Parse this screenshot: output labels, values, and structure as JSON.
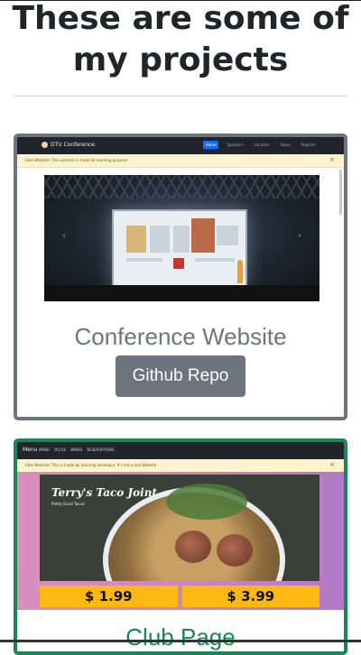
{
  "page": {
    "heading": "These are some of my projects"
  },
  "projects": [
    {
      "title": "Conference Website",
      "button_label": "Github Repo",
      "preview": {
        "brand": "DTU Conference",
        "nav": [
          "Home",
          "Speakers",
          "Location",
          "News",
          "Register"
        ],
        "alert": "Fake Website! This website is made for learning purpose"
      }
    },
    {
      "title": "Club Page",
      "preview": {
        "brand": "Menu",
        "nav": [
          "MENU",
          "TACOS",
          "WINES",
          "RESERVATIONS"
        ],
        "alert": "Fake Website! This is made by learning developer. It's not a real Website",
        "hero_title": "Terry's Taco Joint",
        "hero_subtitle": "Pretty Good Tacos!",
        "prices": [
          "$ 1.99",
          "$ 3.99"
        ]
      }
    }
  ],
  "colors": {
    "secondary": "#6c757d",
    "success": "#198754",
    "price_bg": "#fdb813"
  }
}
